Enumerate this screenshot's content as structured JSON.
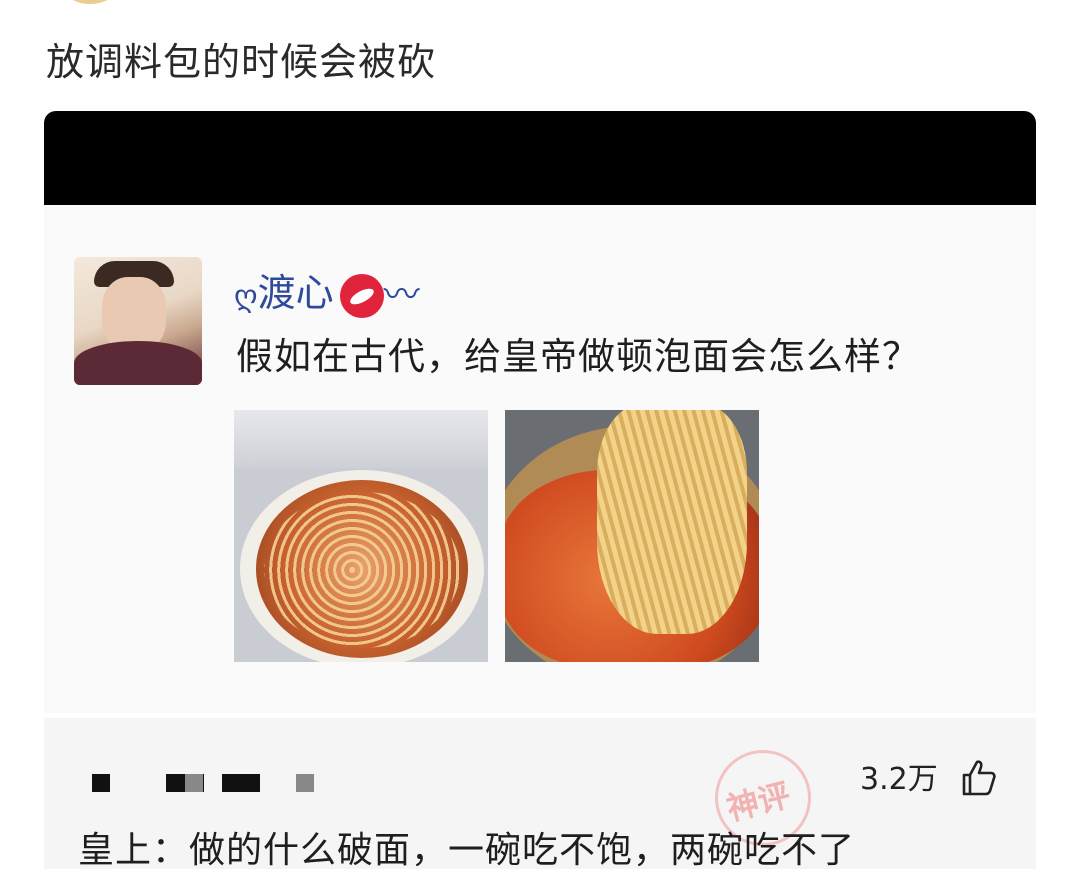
{
  "post": {
    "title": "放调料包的时候会被砍"
  },
  "quoted_post": {
    "username": "渡心",
    "username_prefix": "ღ",
    "question": "假如在古代，给皇帝做顿泡面会怎么样？",
    "images": [
      "instant-noodle-cup-photo",
      "noodles-in-pot-photo"
    ]
  },
  "comment": {
    "likes": "3.2万",
    "text": "皇上：做的什么破面，一碗吃不饱，两碗吃不了",
    "watermark": "神评"
  },
  "colors": {
    "username": "#2e4a9a",
    "redaction": "#000000",
    "comment_bg": "#f5f5f5"
  }
}
